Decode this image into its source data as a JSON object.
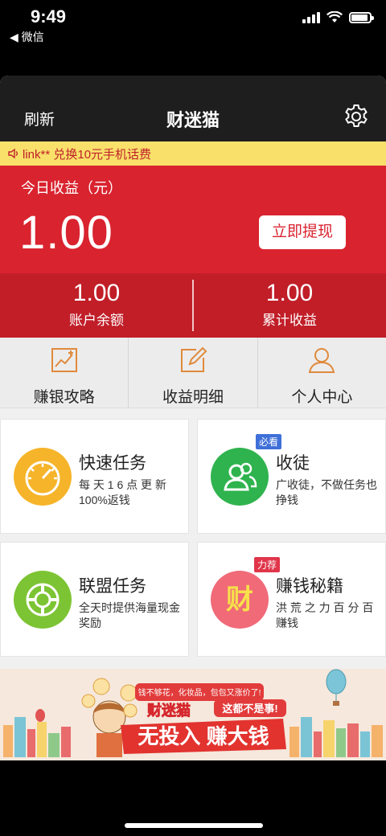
{
  "status_bar": {
    "time": "9:49",
    "back_label": "◀ 微信"
  },
  "navbar": {
    "left_action": "刷新",
    "title": "财迷猫"
  },
  "notice": {
    "text": "link** 兑换10元手机话费"
  },
  "earnings": {
    "label": "今日收益（元）",
    "value": "1.00",
    "withdraw_label": "立即提现"
  },
  "stats": [
    {
      "value": "1.00",
      "label": "账户余额"
    },
    {
      "value": "1.00",
      "label": "累计收益"
    }
  ],
  "shortcuts": [
    {
      "label": "赚银攻略",
      "icon": "chart-icon"
    },
    {
      "label": "收益明细",
      "icon": "edit-icon"
    },
    {
      "label": "个人中心",
      "icon": "person-icon"
    }
  ],
  "cards": [
    {
      "title": "快速任务",
      "desc": "每 天 1 6 点 更 新 100%返钱",
      "icon": "speedometer-icon",
      "color": "#f6b42a"
    },
    {
      "title": "收徒",
      "desc": "广收徒，不做任务也挣钱",
      "badge": "必看",
      "badge_color": "#3f6fd8",
      "icon": "people-icon",
      "color": "#2fb34e"
    },
    {
      "title": "联盟任务",
      "desc": "全天时提供海量现金奖励",
      "icon": "lifebuoy-icon",
      "color": "#7cc433"
    },
    {
      "title": "赚钱秘籍",
      "desc": "洪 荒 之 力 百 分 百 赚钱",
      "badge": "力荐",
      "badge_color": "#e0354a",
      "icon": "cai-character-icon",
      "icon_text": "财",
      "color": "#f06a78"
    }
  ],
  "banner": {
    "line1": "钱不够花，化妆品，包包又涨价了!",
    "line2": "这都不是事!",
    "brand": "财迷猫",
    "slogan": "无投入 赚大钱"
  },
  "colors": {
    "primary_red": "#d9232f",
    "dark_red": "#c11e28",
    "notice_yellow": "#f9e06a",
    "navbar": "#1e1e1e"
  }
}
